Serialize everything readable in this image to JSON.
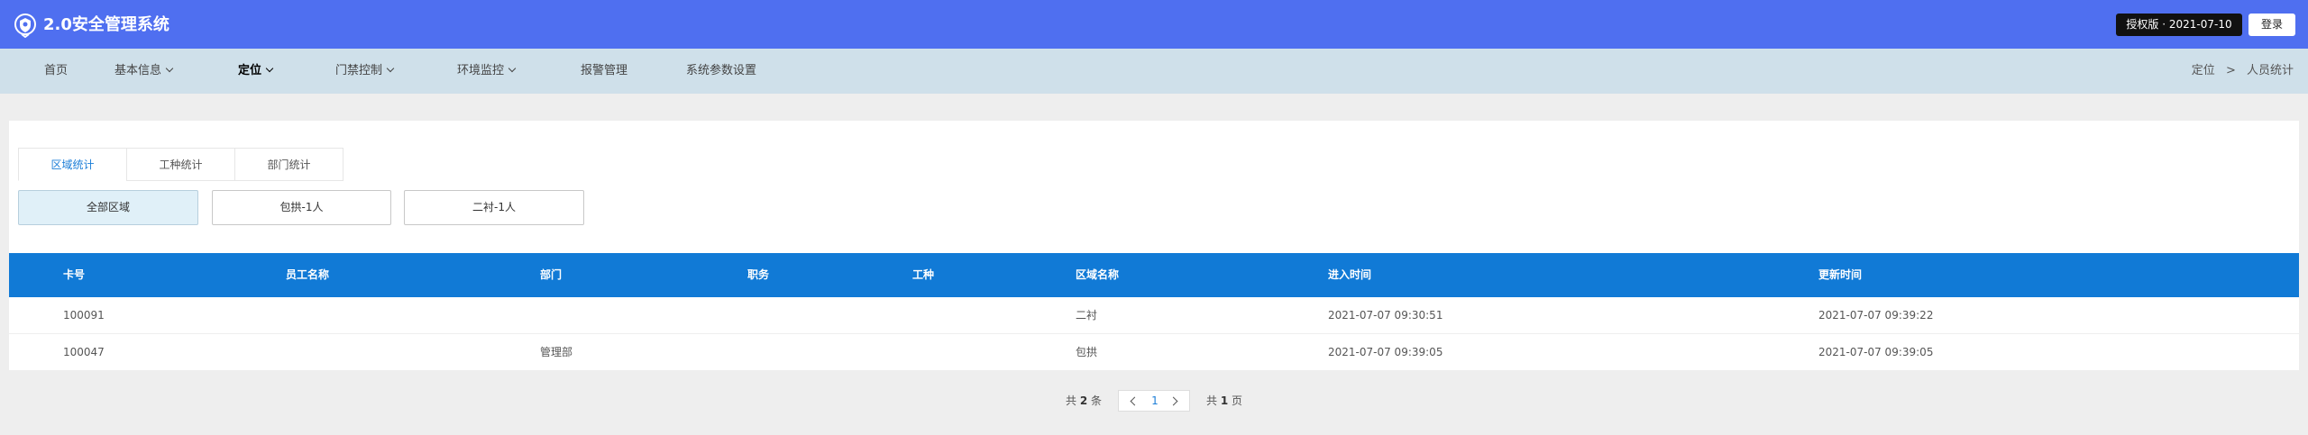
{
  "header": {
    "title": "2.0安全管理系统",
    "license": "授权版 · 2021-07-10",
    "login_label": "登录",
    "logo_icon": "shield-logo-icon",
    "bg_color": "#4f6ff0"
  },
  "nav": {
    "items": [
      {
        "label": "首页"
      },
      {
        "label": "基本信息"
      },
      {
        "label": "定位"
      },
      {
        "label": "门禁控制"
      },
      {
        "label": "环境监控"
      },
      {
        "label": "报警管理"
      },
      {
        "label": "系统参数设置"
      }
    ],
    "active": "定位",
    "breadcrumb": {
      "parent": "定位",
      "separator": ">",
      "current": "人员统计"
    }
  },
  "tabs": [
    {
      "label": "区域统计"
    },
    {
      "label": "工种统计"
    },
    {
      "label": "部门统计"
    }
  ],
  "areas": [
    {
      "label": "全部区域"
    },
    {
      "label": "包拱-1人"
    },
    {
      "label": "二衬-1人"
    }
  ],
  "table": {
    "headers": [
      "卡号",
      "员工名称",
      "部门",
      "职务",
      "工种",
      "区域名称",
      "进入时间",
      "更新时间"
    ],
    "rows": [
      [
        "100091",
        "",
        "",
        "",
        "",
        "二衬",
        "2021-07-07 09:30:51",
        "2021-07-07 09:39:22"
      ],
      [
        "100047",
        "",
        "管理部",
        "",
        "",
        "包拱",
        "2021-07-07 09:39:05",
        "2021-07-07 09:39:05"
      ]
    ],
    "header_color": "#117ad6"
  },
  "pager": {
    "total_prefix": "共",
    "total": "2",
    "total_suffix": "条",
    "current_page": "1",
    "pages_prefix": "共",
    "pages": "1",
    "pages_suffix": "页"
  }
}
